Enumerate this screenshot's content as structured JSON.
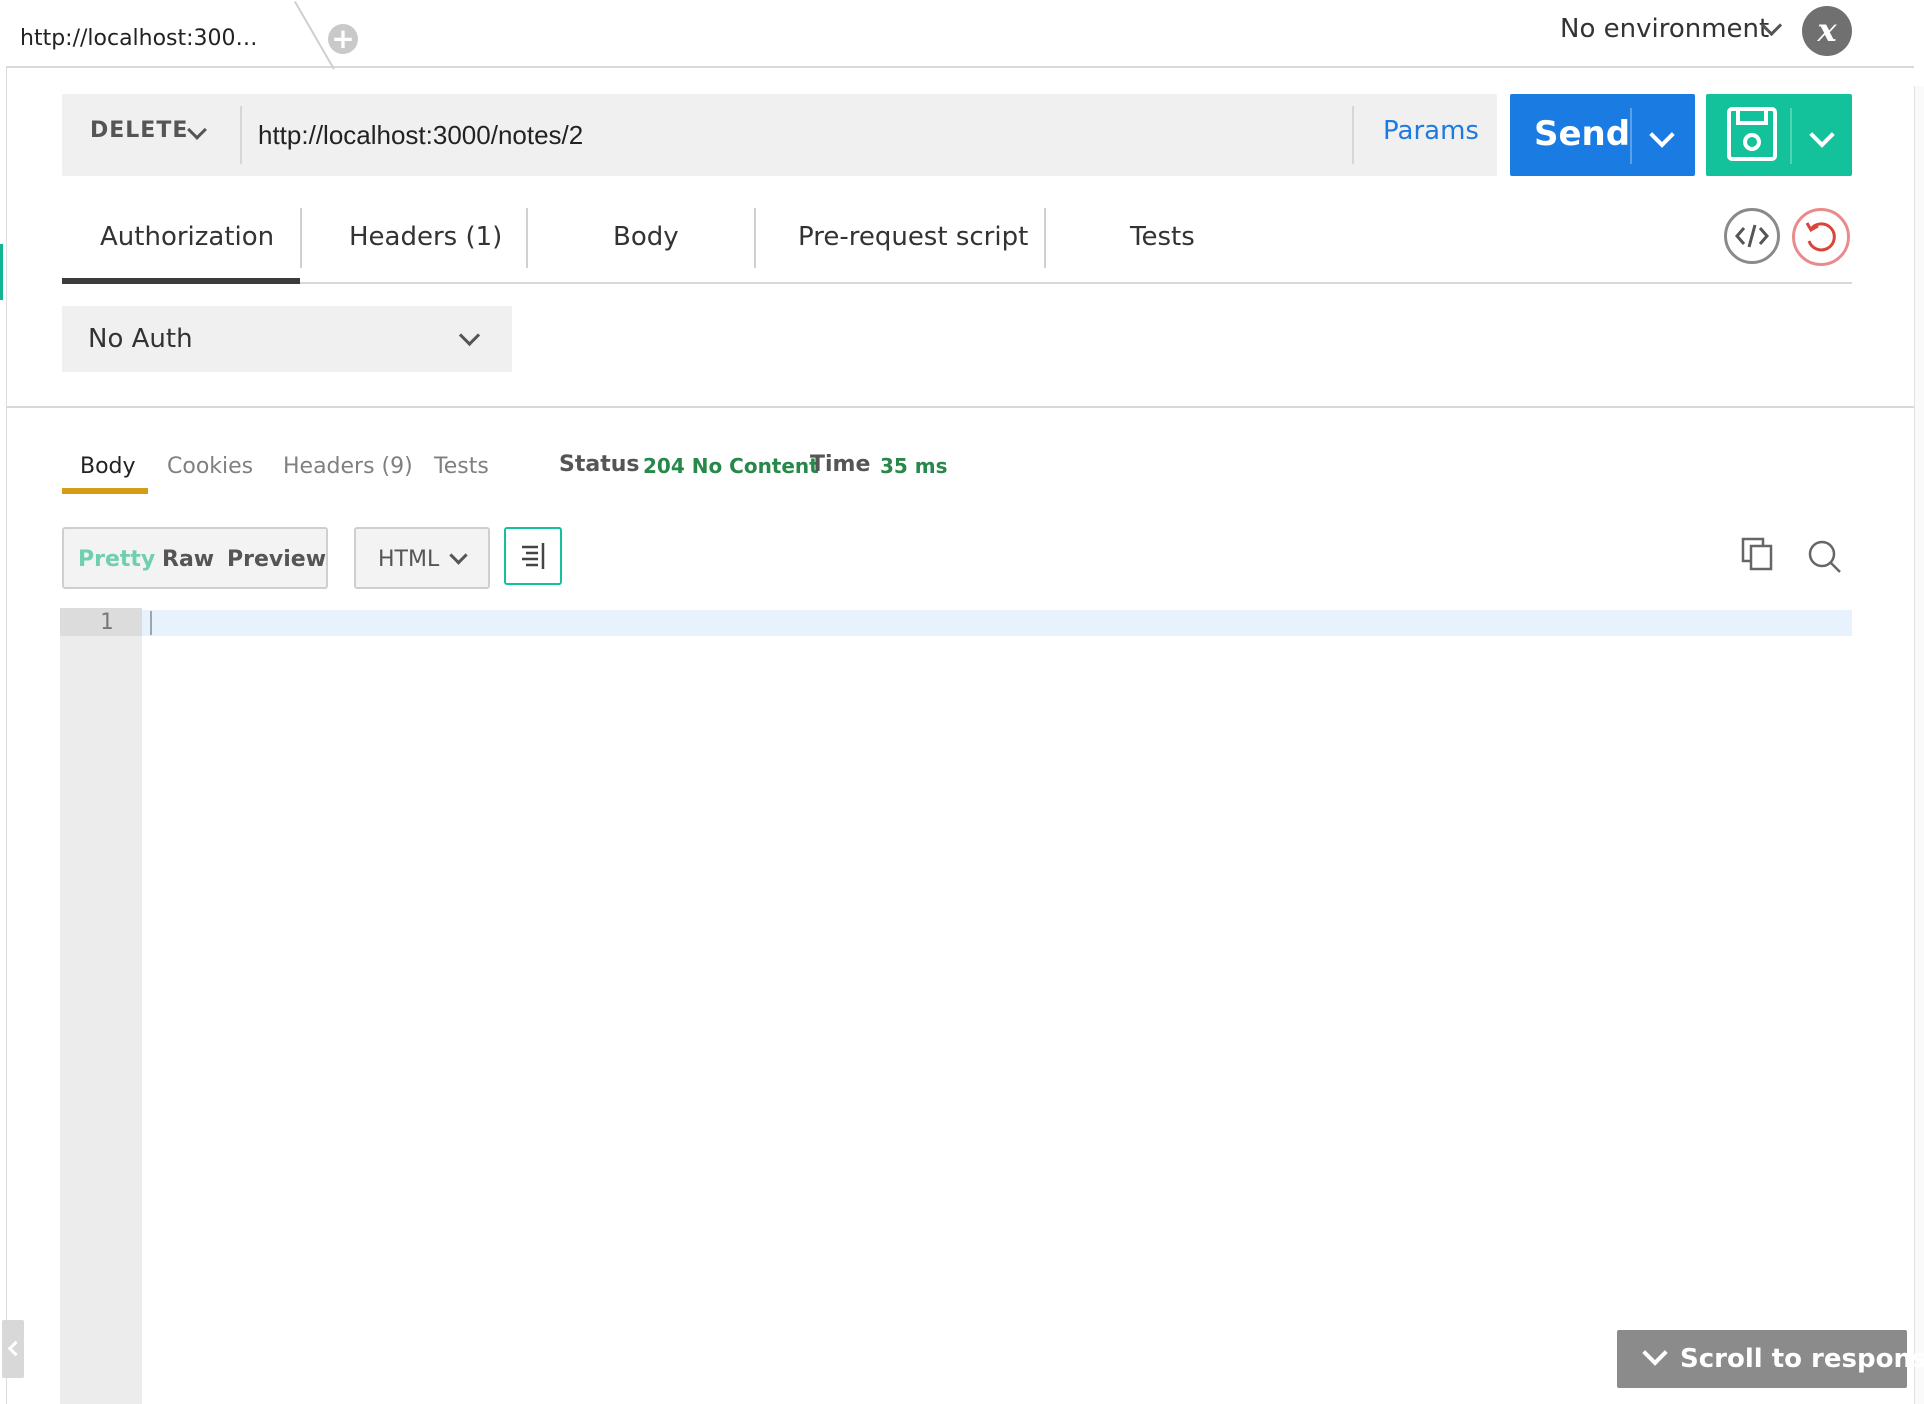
{
  "tabs": {
    "active_title": "http://localhost:300…",
    "new_tab_symbol": "+"
  },
  "environment": {
    "label": "No environment",
    "icon_glyph": "x"
  },
  "request": {
    "method": "DELETE",
    "url": "http://localhost:3000/notes/2",
    "params_label": "Params",
    "send_label": "Send",
    "save_icon": "floppy-disk-icon"
  },
  "request_tabs": [
    {
      "label": "Authorization",
      "active": true
    },
    {
      "label": "Headers (1)",
      "active": false
    },
    {
      "label": "Body",
      "active": false
    },
    {
      "label": "Pre-request script",
      "active": false
    },
    {
      "label": "Tests",
      "active": false
    }
  ],
  "auth": {
    "selected": "No Auth"
  },
  "response": {
    "tabs": [
      {
        "label": "Body",
        "active": true
      },
      {
        "label": "Cookies",
        "active": false
      },
      {
        "label": "Headers (9)",
        "active": false
      },
      {
        "label": "Tests",
        "active": false
      }
    ],
    "status_label": "Status",
    "status_value": "204 No Content",
    "time_label": "Time",
    "time_value": "35 ms",
    "view_modes": {
      "pretty": "Pretty",
      "raw": "Raw",
      "preview": "Preview",
      "active": "Pretty"
    },
    "language": "HTML",
    "line_numbers": [
      "1"
    ]
  },
  "scroll_button_label": "Scroll to response",
  "colors": {
    "send": "#1a7ce3",
    "save": "#13c19a",
    "status_ok": "#27884a",
    "active_response_tab": "#d59d14",
    "params_link": "#1e7bde"
  }
}
